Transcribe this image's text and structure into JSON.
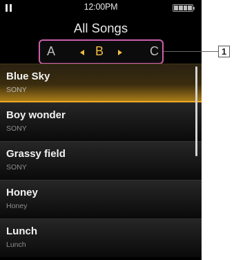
{
  "status": {
    "time": "12:00PM"
  },
  "header": {
    "title": "All Songs"
  },
  "index_bar": {
    "letters": [
      "A",
      "B",
      "C"
    ],
    "selected": "B"
  },
  "callout": {
    "number": "1"
  },
  "songs": [
    {
      "title": "Blue Sky",
      "artist": "SONY",
      "selected": true
    },
    {
      "title": "Boy wonder",
      "artist": "SONY"
    },
    {
      "title": "Grassy field",
      "artist": "SONY"
    },
    {
      "title": "Honey",
      "artist": "Honey"
    },
    {
      "title": "Lunch",
      "artist": "Lunch"
    }
  ],
  "icons": {
    "play_state": "pause-icon",
    "battery": "battery-icon"
  },
  "colors": {
    "accent": "#f2bd44",
    "highlight_border": "#cc5fae",
    "selected_bar": "#f0a81e"
  }
}
